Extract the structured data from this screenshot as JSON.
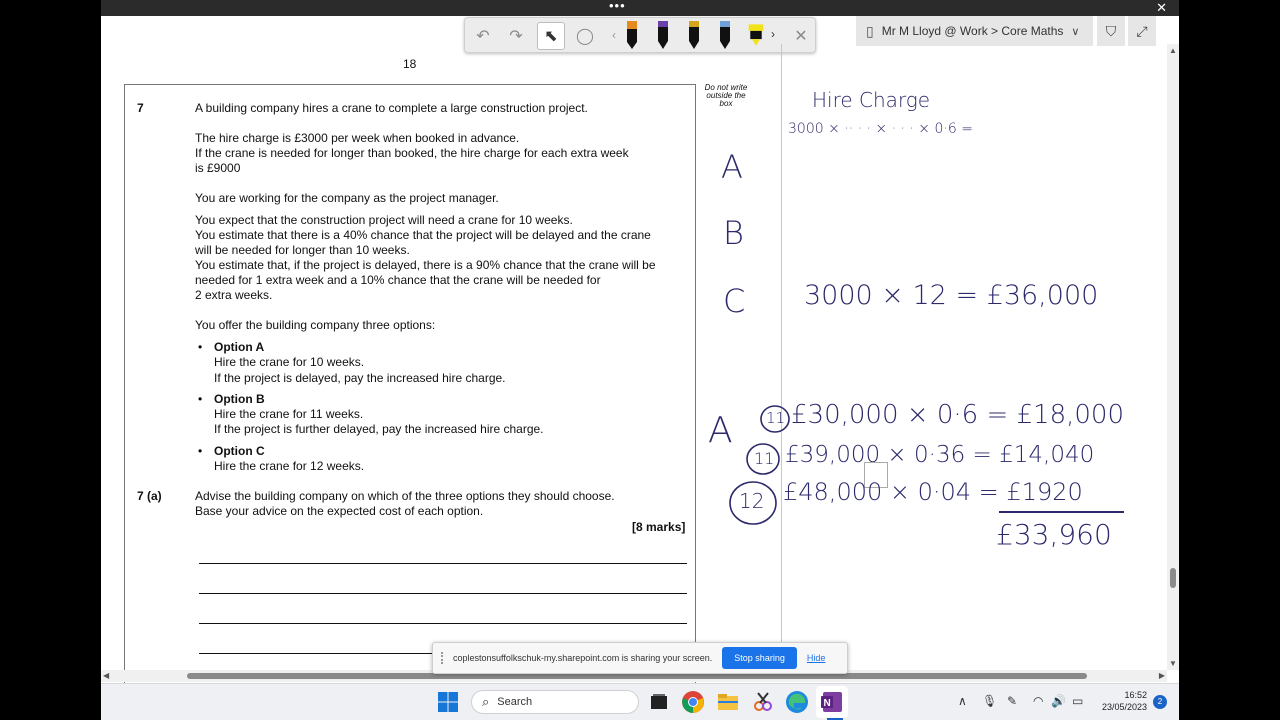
{
  "window": {
    "title_dots": "•••",
    "close_glyph": "✕"
  },
  "ink_toolbar": {
    "undo_icon": "↶",
    "redo_icon": "↷",
    "select_icon": "⬉",
    "lasso_icon": "◯",
    "nav_left": "‹",
    "more": "›",
    "close": "✕",
    "pen_colors": [
      "#e58a1f",
      "#6b3fa8",
      "#d6a51c",
      "#6fa3d8",
      "#f2e21a"
    ]
  },
  "onenote": {
    "breadcrumb": "Mr M Lloyd @ Work > Core Maths",
    "notebook_icon": "▯",
    "chevron": "∨",
    "pin_icon": "⛉",
    "expand_icon": "⤢"
  },
  "page": {
    "page_number": "18",
    "margin_note": "Do not write outside the box",
    "q_number": "7",
    "q_intro": "A building company hires a crane to complete a large construction project.",
    "para1_line1": "The hire charge is £3000 per week when booked in advance.",
    "para1_line2": "If the crane is needed for longer than booked, the hire charge for each extra week",
    "para1_line3": "is £9000",
    "para2": "You are working for the company as the project manager.",
    "para3_line1": "You expect that the construction project will need a crane for 10 weeks.",
    "para3_line2": "You estimate that there is a 40% chance that the project will be delayed and the crane",
    "para3_line3": "will be needed for longer than 10 weeks.",
    "para3_line4": "You estimate that, if the project is delayed, there is a 90% chance that the crane will be",
    "para3_line5": "needed for 1 extra week and a 10% chance that the crane will be needed for",
    "para3_line6": "2 extra weeks.",
    "para4": "You offer the building company three options:",
    "bullet": "•",
    "optA_title": "Option A",
    "optA_l1": "Hire the crane for 10 weeks.",
    "optA_l2": "If the project is delayed, pay the increased hire charge.",
    "optB_title": "Option B",
    "optB_l1": "Hire the crane for 11 weeks.",
    "optB_l2": "If the project is further delayed, pay the increased hire charge.",
    "optC_title": "Option C",
    "optC_l1": "Hire the crane for 12 weeks.",
    "part_label": "7  (a)",
    "part_l1": "Advise the building company on which of the three options they should choose.",
    "part_l2": "Base your advice on the expected cost of each option.",
    "marks": "[8 marks]"
  },
  "ink": {
    "hire_charge": "Hire Charge",
    "hire_calc": "3000 ×  ··     · · × · · ·    × 0·6 =",
    "letter_A": "A",
    "letter_B": "B",
    "letter_C": "C",
    "calc_C": "3000 × 12 = £36,000",
    "calc_A": "A",
    "row1_circle": "11",
    "row1": "£30,000 × 0·6 = £18,000",
    "row2_circle": "11",
    "row2": "£39,000  × 0·36 = £14,040",
    "row3_circle": "12",
    "row3": "£48,000  × 0·04 = £1920",
    "total": "£33,960"
  },
  "share_bar": {
    "message": "coplestonsuffolkschuk-my.sharepoint.com is sharing your screen.",
    "stop_label": "Stop sharing",
    "hide_label": "Hide"
  },
  "taskbar": {
    "search_placeholder": "Search",
    "search_icon": "⌕",
    "time": "16:52",
    "date": "23/05/2023",
    "notification_count": "2",
    "tray_chevron": "∧",
    "mic_icon": "🎙",
    "pen_icon": "✎",
    "wifi_icon": "◠",
    "volume_icon": "🔊",
    "battery_icon": "▭"
  }
}
